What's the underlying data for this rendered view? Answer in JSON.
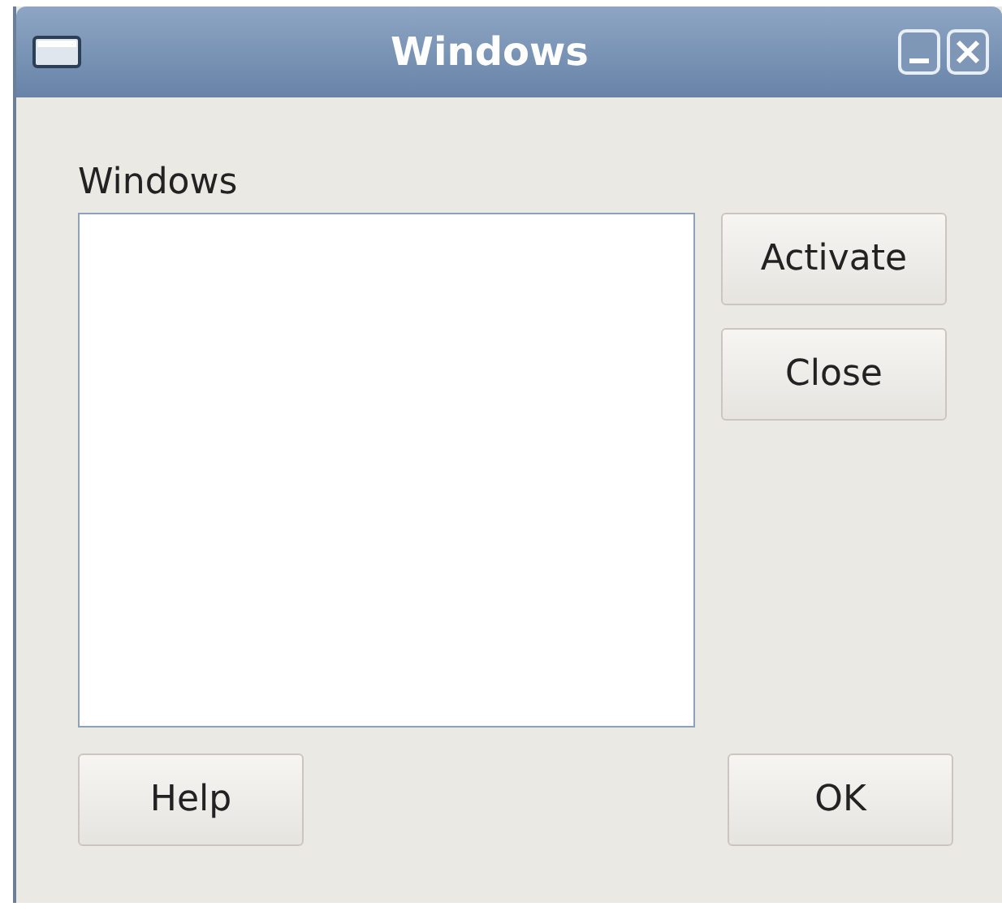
{
  "window": {
    "title": "Windows"
  },
  "list": {
    "label": "Windows"
  },
  "side_buttons": [
    "Activate",
    "Close"
  ],
  "bottom_buttons": [
    "Help",
    "OK"
  ]
}
